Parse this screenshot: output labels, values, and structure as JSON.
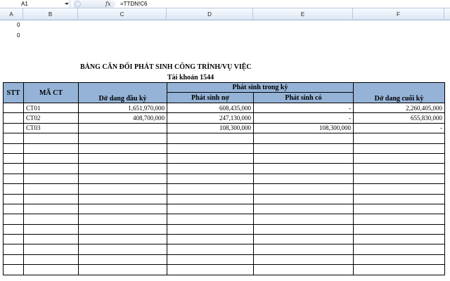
{
  "formula_bar": {
    "name_box": "A1",
    "fx_label": "fx",
    "formula": "=TTDN!C6"
  },
  "columns": [
    "A",
    "B",
    "C",
    "D",
    "E",
    "F"
  ],
  "cells": {
    "a1": "0",
    "a2": "0"
  },
  "report": {
    "title": "BẢNG CÂN ĐỐI PHÁT SINH CÔNG TRÌNH/VỤ VIỆC",
    "subtitle": "Tài khoản 1544",
    "headers": {
      "stt": "STT",
      "ma_ct": "MÃ CT",
      "do_dang_dau_ky": "Dở dang đầu kỳ",
      "phat_sinh_trong_ky": "Phát sinh trong kỳ",
      "phat_sinh_no": "Phát sinh nợ",
      "phat_sinh_co": "Phát sinh có",
      "do_dang_cuoi_ky": "Dở dang cuối kỳ"
    },
    "rows": [
      {
        "stt": "",
        "ma_ct": "CT01",
        "dau_ky": "1,651,970,000",
        "no": "608,435,000",
        "co": "-",
        "cuoi_ky": "2,260,405,000"
      },
      {
        "stt": "",
        "ma_ct": "CT02",
        "dau_ky": "408,700,000",
        "no": "247,130,000",
        "co": "-",
        "cuoi_ky": "655,830,000"
      },
      {
        "stt": "",
        "ma_ct": "CT03",
        "dau_ky": "",
        "no": "108,300,000",
        "co": "108,300,000",
        "cuoi_ky": "-"
      }
    ],
    "empty_rows": 14
  }
}
